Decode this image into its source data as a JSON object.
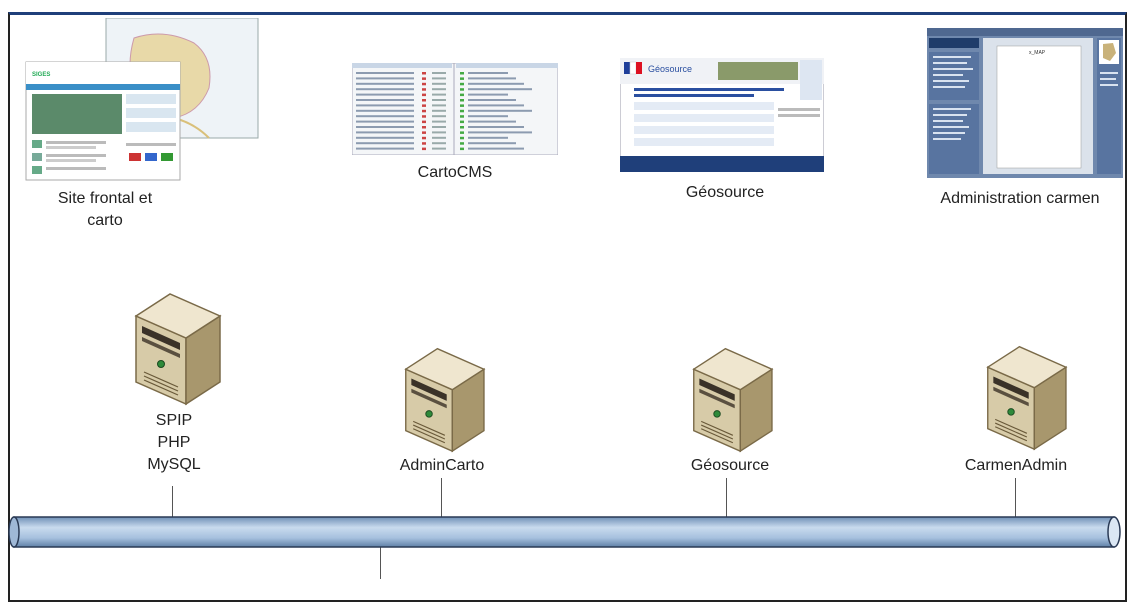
{
  "apps": [
    {
      "label": "Site frontal et\ncarto"
    },
    {
      "label": "CartoCMS"
    },
    {
      "label": "Géosource"
    },
    {
      "label": "Administration carmen"
    }
  ],
  "servers": [
    {
      "label_lines": [
        "SPIP",
        "PHP",
        "MySQL"
      ]
    },
    {
      "label_lines": [
        "AdminCarto"
      ]
    },
    {
      "label_lines": [
        "Géosource"
      ]
    },
    {
      "label_lines": [
        "CarmenAdmin"
      ]
    }
  ],
  "thumbnail_texts": {
    "geosource_logo": "Géosource",
    "carmen_title": "x_MAP"
  },
  "colors": {
    "frame_top": "#1f3f7a",
    "pipe_fill": "#b9cfe6",
    "pipe_dark": "#6f90b6",
    "server_light": "#efe6cf",
    "server_mid": "#d4c6a3",
    "server_dark": "#8e7e5a"
  }
}
